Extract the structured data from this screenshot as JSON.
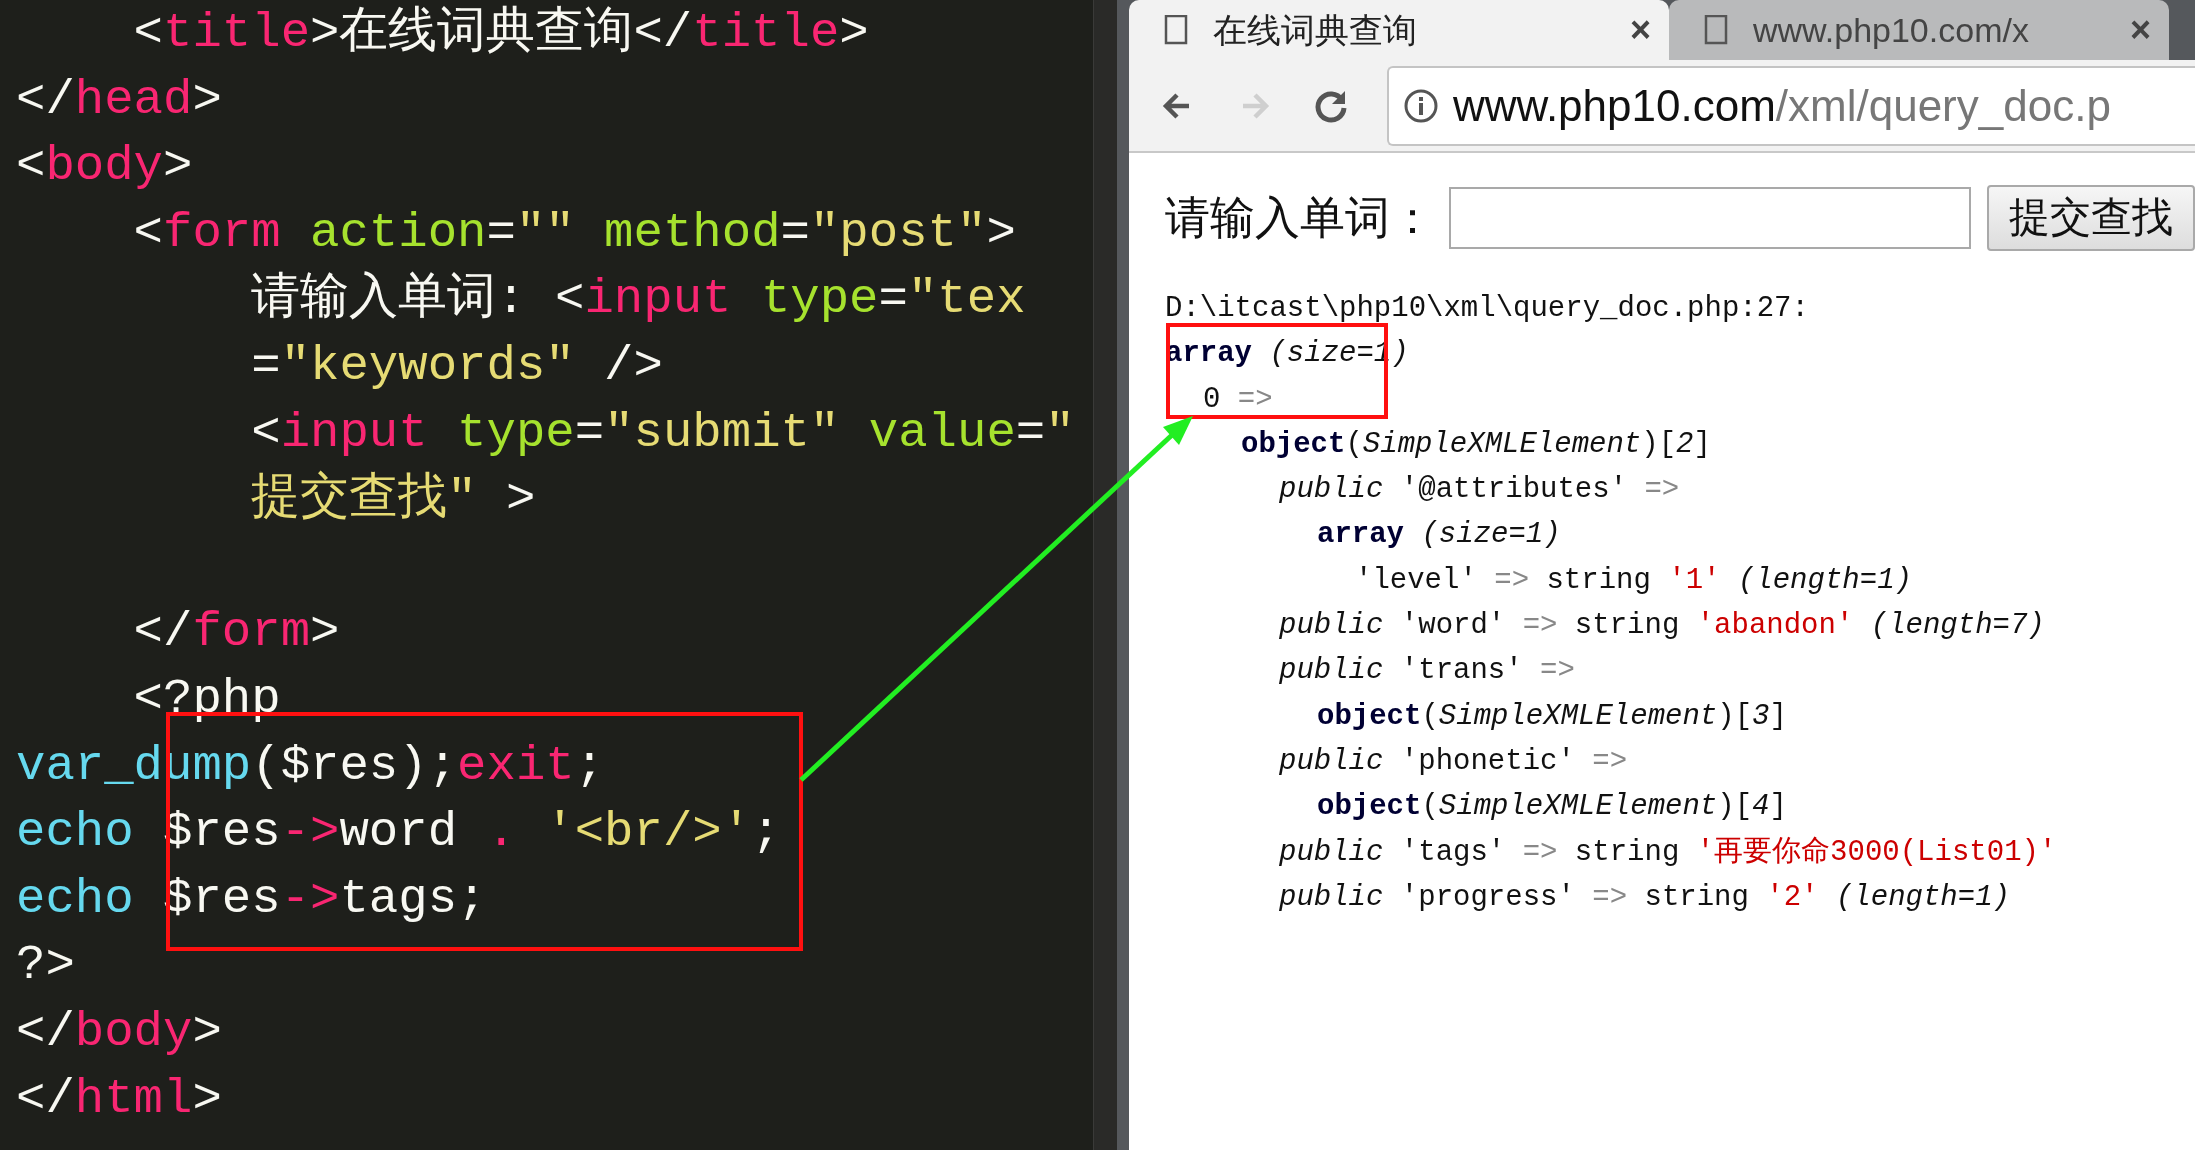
{
  "editor": {
    "lines": [
      {
        "tokens": [
          {
            "kind": "plain",
            "text": "    <"
          },
          {
            "kind": "tag",
            "text": "title"
          },
          {
            "kind": "plain",
            "text": ">在线词典查询</"
          },
          {
            "kind": "tag",
            "text": "title"
          },
          {
            "kind": "plain",
            "text": ">"
          }
        ]
      },
      {
        "tokens": [
          {
            "kind": "plain",
            "text": "</"
          },
          {
            "kind": "tag",
            "text": "head"
          },
          {
            "kind": "plain",
            "text": ">"
          }
        ]
      },
      {
        "tokens": [
          {
            "kind": "plain",
            "text": "<"
          },
          {
            "kind": "tag",
            "text": "body"
          },
          {
            "kind": "plain",
            "text": ">"
          }
        ]
      },
      {
        "tokens": [
          {
            "kind": "plain",
            "text": "    <"
          },
          {
            "kind": "tag",
            "text": "form"
          },
          {
            "kind": "attr",
            "text": " action"
          },
          {
            "kind": "plain",
            "text": "="
          },
          {
            "kind": "string",
            "text": "\"\""
          },
          {
            "kind": "attr",
            "text": " method"
          },
          {
            "kind": "plain",
            "text": "="
          },
          {
            "kind": "string",
            "text": "\"post\""
          },
          {
            "kind": "plain",
            "text": ">"
          }
        ]
      },
      {
        "tokens": [
          {
            "kind": "plain",
            "text": "        请输入单词: <"
          },
          {
            "kind": "tag",
            "text": "input"
          },
          {
            "kind": "attr",
            "text": " type"
          },
          {
            "kind": "plain",
            "text": "="
          },
          {
            "kind": "string",
            "text": "\"tex"
          }
        ]
      },
      {
        "tokens": [
          {
            "kind": "plain",
            "text": "        ="
          },
          {
            "kind": "string",
            "text": "\"keywords\""
          },
          {
            "kind": "plain",
            "text": " />"
          }
        ]
      },
      {
        "tokens": [
          {
            "kind": "plain",
            "text": "        <"
          },
          {
            "kind": "tag",
            "text": "input"
          },
          {
            "kind": "attr",
            "text": " type"
          },
          {
            "kind": "plain",
            "text": "="
          },
          {
            "kind": "string",
            "text": "\"submit\""
          },
          {
            "kind": "attr",
            "text": " value"
          },
          {
            "kind": "plain",
            "text": "="
          },
          {
            "kind": "string",
            "text": "\""
          }
        ]
      },
      {
        "tokens": [
          {
            "kind": "string",
            "text": "        提交查找\""
          },
          {
            "kind": "plain",
            "text": " >"
          }
        ]
      },
      {
        "blank_line_before": true,
        "tokens": [
          {
            "kind": "plain",
            "text": "    </"
          },
          {
            "kind": "tag",
            "text": "form"
          },
          {
            "kind": "plain",
            "text": ">"
          }
        ]
      },
      {
        "tokens": [
          {
            "kind": "plain",
            "text": "    <?php"
          }
        ]
      },
      {
        "tokens": [
          {
            "kind": "func",
            "text": "var_dump"
          },
          {
            "kind": "plain",
            "text": "($res);"
          },
          {
            "kind": "tag",
            "text": "exit"
          },
          {
            "kind": "plain",
            "text": ";"
          }
        ]
      },
      {
        "tokens": [
          {
            "kind": "func",
            "text": "echo"
          },
          {
            "kind": "plain",
            "text": " $res"
          },
          {
            "kind": "tag",
            "text": "->"
          },
          {
            "kind": "plain",
            "text": "word"
          },
          {
            "kind": "tag",
            "text": " ."
          },
          {
            "kind": "string",
            "text": " '<br/>'"
          },
          {
            "kind": "plain",
            "text": ";"
          }
        ]
      },
      {
        "tokens": [
          {
            "kind": "func",
            "text": "echo"
          },
          {
            "kind": "plain",
            "text": " $res"
          },
          {
            "kind": "tag",
            "text": "->"
          },
          {
            "kind": "plain",
            "text": "tags;"
          }
        ]
      },
      {
        "tokens": [
          {
            "kind": "plain",
            "text": "?>"
          }
        ]
      },
      {
        "tokens": [
          {
            "kind": "plain",
            "text": "</"
          },
          {
            "kind": "tag",
            "text": "body"
          },
          {
            "kind": "plain",
            "text": ">"
          }
        ]
      },
      {
        "tokens": [
          {
            "kind": "plain",
            "text": "</"
          },
          {
            "kind": "tag",
            "text": "html"
          },
          {
            "kind": "plain",
            "text": ">"
          }
        ]
      }
    ]
  },
  "browser": {
    "tabs": [
      {
        "title": "在线词典查询",
        "close": "×",
        "selected": true
      },
      {
        "title": "www.php10.com/x",
        "close": "×",
        "selected": false
      }
    ],
    "nav_buttons": [
      {
        "kind": "back",
        "disabled": false
      },
      {
        "kind": "forward",
        "disabled": true
      },
      {
        "kind": "reload",
        "disabled": false
      }
    ],
    "address": {
      "host": "www.php10.com",
      "path": "/xml/query_doc.p"
    },
    "page": {
      "label": "请输入单词：",
      "button": "提交查找",
      "dump": {
        "header": "D:\\itcast\\php10\\xml\\query_doc.php:27:",
        "tree": [
          {
            "tokens": [
              {
                "kind": "bold",
                "text": "array"
              },
              {
                "kind": "italic",
                "text": " (size=1)"
              }
            ],
            "children": [
              {
                "tokens": [
                  {
                    "kind": "plain",
                    "text": "0 "
                  },
                  {
                    "kind": "op",
                    "text": "=>"
                  }
                ],
                "children": [
                  {
                    "tokens": [
                      {
                        "kind": "bold",
                        "text": "object"
                      },
                      {
                        "kind": "plain",
                        "text": "("
                      },
                      {
                        "kind": "italic",
                        "text": "SimpleXMLElement"
                      },
                      {
                        "kind": "plain",
                        "text": ")["
                      },
                      {
                        "kind": "italic",
                        "text": "2"
                      },
                      {
                        "kind": "plain",
                        "text": "]"
                      }
                    ],
                    "children": [
                      {
                        "tokens": [
                          {
                            "kind": "italic",
                            "text": "public"
                          },
                          {
                            "kind": "plain",
                            "text": " '@attributes' "
                          },
                          {
                            "kind": "op",
                            "text": "=>"
                          }
                        ],
                        "children": [
                          {
                            "tokens": [
                              {
                                "kind": "bold",
                                "text": "array"
                              },
                              {
                                "kind": "italic",
                                "text": " (size=1)"
                              }
                            ],
                            "children": [
                              {
                                "tokens": [
                                  {
                                    "kind": "plain",
                                    "text": "'level' "
                                  },
                                  {
                                    "kind": "op",
                                    "text": "=>"
                                  },
                                  {
                                    "kind": "plain",
                                    "text": " string "
                                  },
                                  {
                                    "kind": "red",
                                    "text": "'1'"
                                  },
                                  {
                                    "kind": "italic",
                                    "text": " (length=1)"
                                  }
                                ]
                              }
                            ]
                          }
                        ]
                      },
                      {
                        "tokens": [
                          {
                            "kind": "italic",
                            "text": "public"
                          },
                          {
                            "kind": "plain",
                            "text": " 'word' "
                          },
                          {
                            "kind": "op",
                            "text": "=>"
                          },
                          {
                            "kind": "plain",
                            "text": " string "
                          },
                          {
                            "kind": "red",
                            "text": "'abandon'"
                          },
                          {
                            "kind": "italic",
                            "text": " (length=7)"
                          }
                        ]
                      },
                      {
                        "tokens": [
                          {
                            "kind": "italic",
                            "text": "public"
                          },
                          {
                            "kind": "plain",
                            "text": " 'trans' "
                          },
                          {
                            "kind": "op",
                            "text": "=>"
                          }
                        ],
                        "children": [
                          {
                            "tokens": [
                              {
                                "kind": "bold",
                                "text": "object"
                              },
                              {
                                "kind": "plain",
                                "text": "("
                              },
                              {
                                "kind": "italic",
                                "text": "SimpleXMLElement"
                              },
                              {
                                "kind": "plain",
                                "text": ")["
                              },
                              {
                                "kind": "italic",
                                "text": "3"
                              },
                              {
                                "kind": "plain",
                                "text": "]"
                              }
                            ]
                          }
                        ]
                      },
                      {
                        "tokens": [
                          {
                            "kind": "italic",
                            "text": "public"
                          },
                          {
                            "kind": "plain",
                            "text": " 'phonetic' "
                          },
                          {
                            "kind": "op",
                            "text": "=>"
                          }
                        ],
                        "children": [
                          {
                            "tokens": [
                              {
                                "kind": "bold",
                                "text": "object"
                              },
                              {
                                "kind": "plain",
                                "text": "("
                              },
                              {
                                "kind": "italic",
                                "text": "SimpleXMLElement"
                              },
                              {
                                "kind": "plain",
                                "text": ")["
                              },
                              {
                                "kind": "italic",
                                "text": "4"
                              },
                              {
                                "kind": "plain",
                                "text": "]"
                              }
                            ]
                          }
                        ]
                      },
                      {
                        "tokens": [
                          {
                            "kind": "italic",
                            "text": "public"
                          },
                          {
                            "kind": "plain",
                            "text": " 'tags' "
                          },
                          {
                            "kind": "op",
                            "text": "=>"
                          },
                          {
                            "kind": "plain",
                            "text": " string "
                          },
                          {
                            "kind": "red",
                            "text": "'再要你命3000(List01)'"
                          }
                        ]
                      },
                      {
                        "tokens": [
                          {
                            "kind": "italic",
                            "text": "public"
                          },
                          {
                            "kind": "plain",
                            "text": " 'progress' "
                          },
                          {
                            "kind": "op",
                            "text": "=>"
                          },
                          {
                            "kind": "plain",
                            "text": " string "
                          },
                          {
                            "kind": "red",
                            "text": "'2'"
                          },
                          {
                            "kind": "italic",
                            "text": " (length=1)"
                          }
                        ]
                      }
                    ]
                  }
                ]
              }
            ]
          }
        ]
      }
    }
  }
}
